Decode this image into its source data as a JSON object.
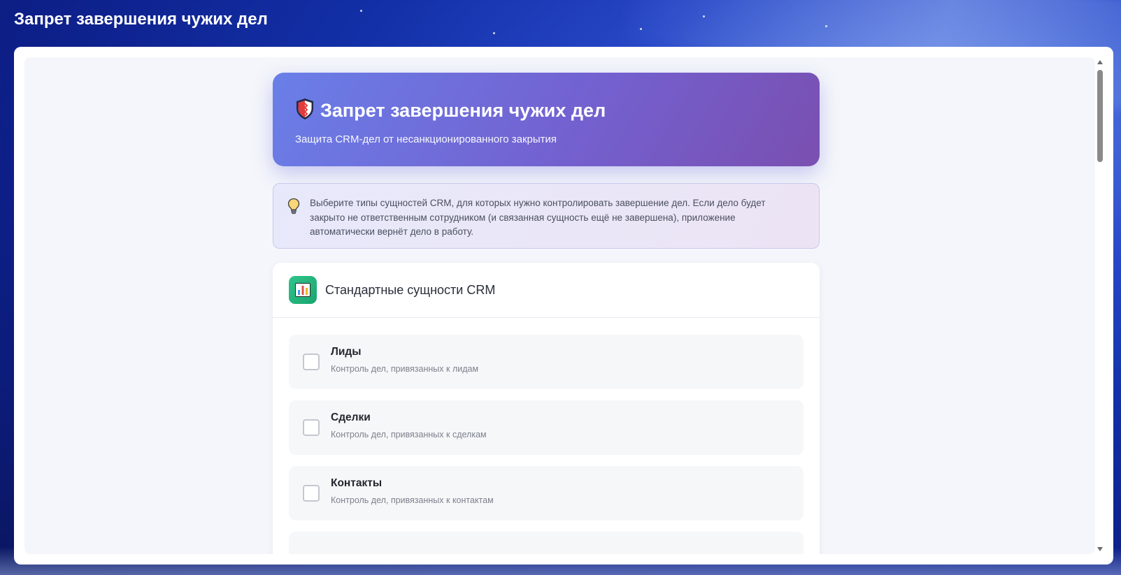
{
  "window": {
    "title": "Запрет завершения чужих дел"
  },
  "hero": {
    "title": "Запрет завершения чужих дел",
    "subtitle": "Защита CRM-дел от несанкционированного закрытия",
    "icon": "shield-icon"
  },
  "tip": {
    "icon": "lightbulb-icon",
    "text": "Выберите типы сущностей CRM, для которых нужно контролировать завершение дел. Если дело будет закрыто не ответственным сотрудником (и связанная сущность ещё не завершена), приложение автоматически вернёт дело в работу."
  },
  "standard_entities": {
    "icon": "bar-chart-icon",
    "title": "Стандартные сущности CRM",
    "items": [
      {
        "label": "Лиды",
        "description": "Контроль дел, привязанных к лидам",
        "checked": false
      },
      {
        "label": "Сделки",
        "description": "Контроль дел, привязанных к сделкам",
        "checked": false
      },
      {
        "label": "Контакты",
        "description": "Контроль дел, привязанных к контактам",
        "checked": false
      }
    ]
  },
  "colors": {
    "hero_gradient_start": "#6a7fe8",
    "hero_gradient_end": "#7a4fb0",
    "card_icon_bg": "#2fc48b",
    "page_bg": "#f4f6fb"
  }
}
